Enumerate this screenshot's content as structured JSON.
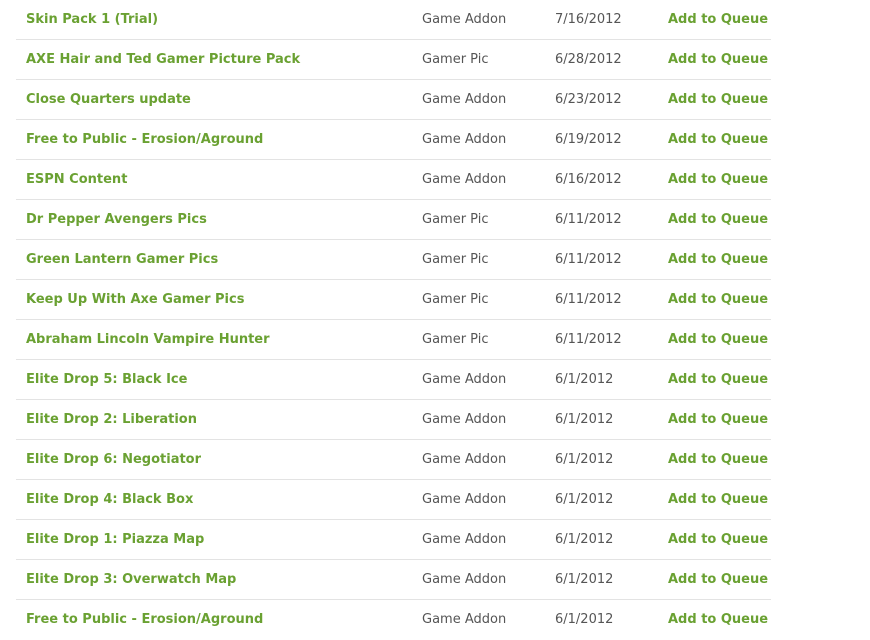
{
  "queue_label": "Add to Queue",
  "items": [
    {
      "title": "Skin Pack 1 (Trial)",
      "type": "Game Addon",
      "date": "7/16/2012"
    },
    {
      "title": "AXE Hair and Ted Gamer Picture Pack",
      "type": "Gamer Pic",
      "date": "6/28/2012"
    },
    {
      "title": "Close Quarters update",
      "type": "Game Addon",
      "date": "6/23/2012"
    },
    {
      "title": "Free to Public - Erosion/Aground",
      "type": "Game Addon",
      "date": "6/19/2012"
    },
    {
      "title": "ESPN Content",
      "type": "Game Addon",
      "date": "6/16/2012"
    },
    {
      "title": "Dr Pepper Avengers Pics",
      "type": "Gamer Pic",
      "date": "6/11/2012"
    },
    {
      "title": "Green Lantern Gamer Pics",
      "type": "Gamer Pic",
      "date": "6/11/2012"
    },
    {
      "title": "Keep Up With Axe Gamer Pics",
      "type": "Gamer Pic",
      "date": "6/11/2012"
    },
    {
      "title": "Abraham Lincoln Vampire Hunter",
      "type": "Gamer Pic",
      "date": "6/11/2012"
    },
    {
      "title": "Elite Drop 5: Black Ice",
      "type": "Game Addon",
      "date": "6/1/2012"
    },
    {
      "title": "Elite Drop 2: Liberation",
      "type": "Game Addon",
      "date": "6/1/2012"
    },
    {
      "title": "Elite Drop 6: Negotiator",
      "type": "Game Addon",
      "date": "6/1/2012"
    },
    {
      "title": "Elite Drop 4: Black Box",
      "type": "Game Addon",
      "date": "6/1/2012"
    },
    {
      "title": "Elite Drop 1: Piazza Map",
      "type": "Game Addon",
      "date": "6/1/2012"
    },
    {
      "title": "Elite Drop 3: Overwatch Map",
      "type": "Game Addon",
      "date": "6/1/2012"
    },
    {
      "title": "Free to Public - Erosion/Aground",
      "type": "Game Addon",
      "date": "6/1/2012"
    }
  ]
}
